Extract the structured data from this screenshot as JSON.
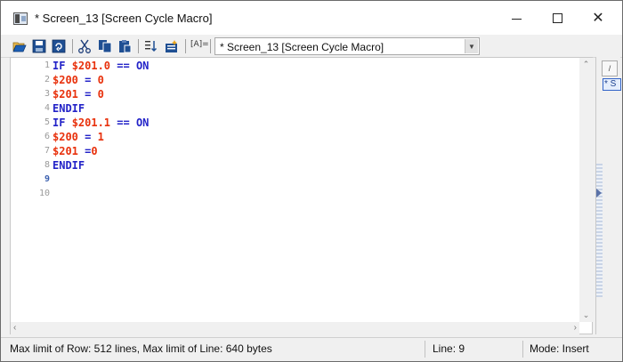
{
  "window": {
    "title": "* Screen_13 [Screen Cycle Macro]",
    "controls": {
      "minimize": "minimize",
      "maximize": "maximize",
      "close": "✕"
    }
  },
  "toolbar": {
    "buttons": [
      {
        "name": "open-icon",
        "glyph": "📂"
      },
      {
        "name": "save-icon",
        "glyph": "💾"
      },
      {
        "name": "refresh-icon",
        "glyph": "⟳"
      },
      {
        "name": "cut-icon",
        "glyph": "✂"
      },
      {
        "name": "copy-icon",
        "glyph": "⧉"
      },
      {
        "name": "paste-icon",
        "glyph": "📋"
      },
      {
        "name": "sort-icon",
        "glyph": "⇅"
      },
      {
        "name": "insert-icon",
        "glyph": "⊞"
      }
    ],
    "format_label": "[A]=",
    "combo_value": "* Screen_13 [Screen Cycle Macro]"
  },
  "editor": {
    "line_numbers": [
      "1",
      "2",
      "3",
      "4",
      "5",
      "6",
      "7",
      "8",
      "9",
      "10"
    ],
    "current_line": "9",
    "lines": [
      [
        {
          "t": "IF ",
          "c": "kw"
        },
        {
          "t": "$201.0",
          "c": "var"
        },
        {
          "t": " == ON",
          "c": "kw"
        }
      ],
      [
        {
          "t": "$200",
          "c": "var"
        },
        {
          "t": " = ",
          "c": "op"
        },
        {
          "t": "0",
          "c": "var"
        }
      ],
      [
        {
          "t": "$201",
          "c": "var"
        },
        {
          "t": " = ",
          "c": "op"
        },
        {
          "t": "0",
          "c": "var"
        }
      ],
      [
        {
          "t": "ENDIF",
          "c": "kw"
        }
      ],
      [
        {
          "t": "IF ",
          "c": "kw"
        },
        {
          "t": "$201.1",
          "c": "var"
        },
        {
          "t": " == ON",
          "c": "kw"
        }
      ],
      [
        {
          "t": "$200",
          "c": "var"
        },
        {
          "t": " = ",
          "c": "op"
        },
        {
          "t": "1",
          "c": "var"
        }
      ],
      [
        {
          "t": "$201",
          "c": "var"
        },
        {
          "t": " =",
          "c": "op"
        },
        {
          "t": "0",
          "c": "var"
        }
      ],
      [
        {
          "t": "ENDIF",
          "c": "kw"
        }
      ],
      [],
      []
    ],
    "colors": {
      "keyword": "#2323c8",
      "variable": "#e8310c",
      "line_number": "#9a9a9a"
    }
  },
  "right_panel": {
    "tab_label": "/",
    "item_label": "* S"
  },
  "status": {
    "limits": "Max limit of Row: 512 lines, Max limit of Line: 640 bytes",
    "line": "Line: 9",
    "mode": "Mode: Insert"
  }
}
